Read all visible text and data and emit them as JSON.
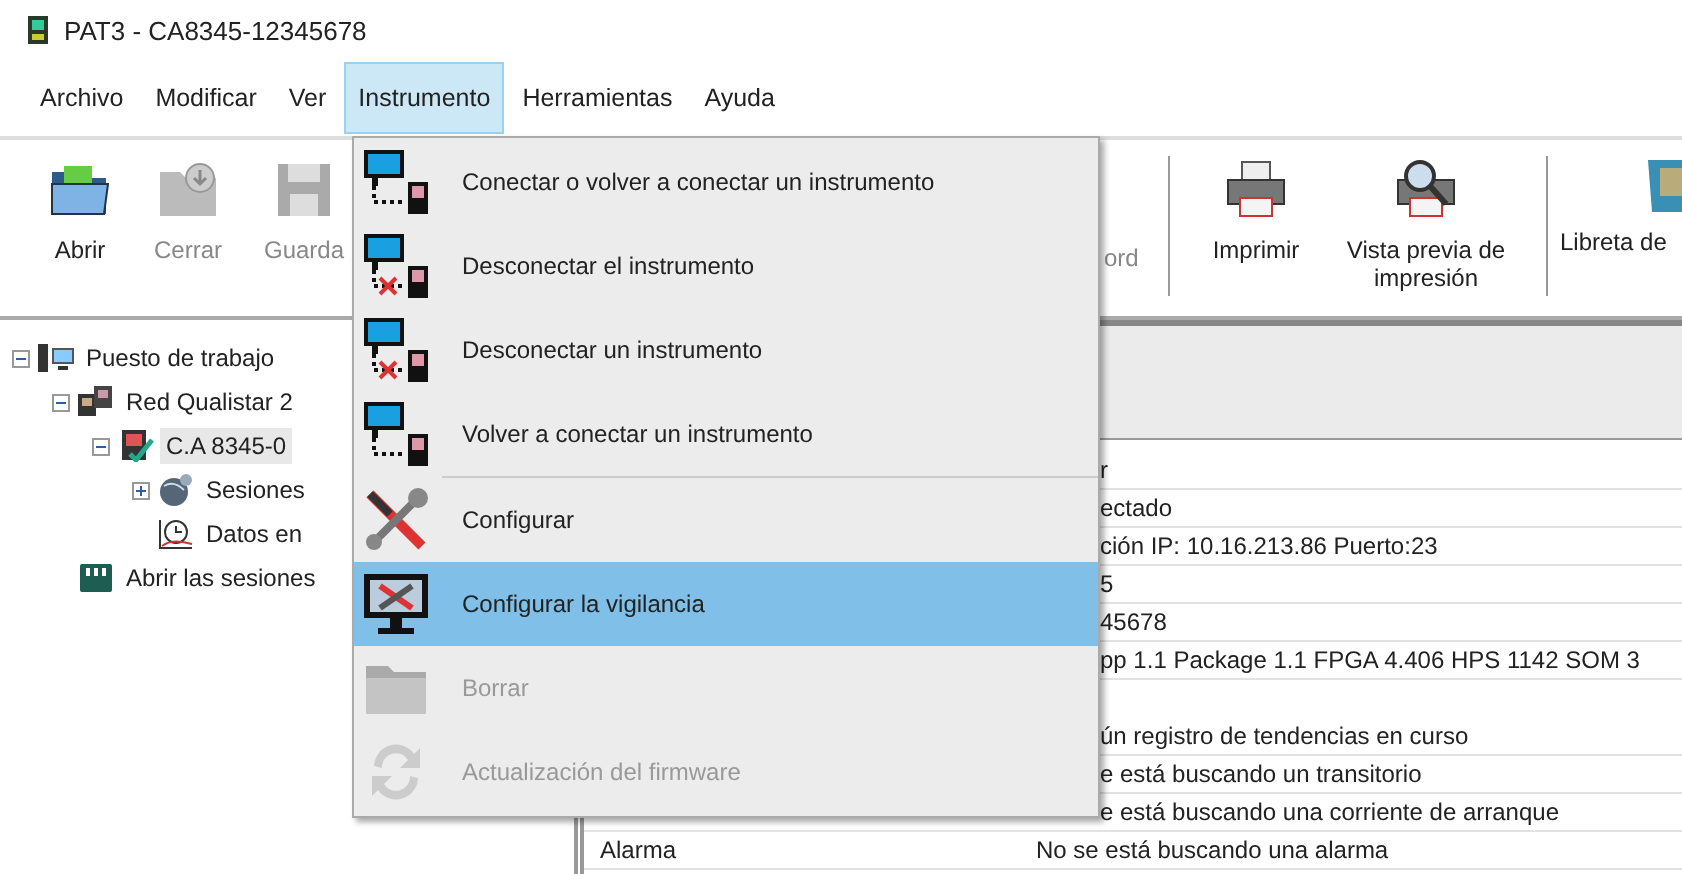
{
  "window": {
    "title": "PAT3 - CA8345-12345678"
  },
  "menu_bar": [
    {
      "label": "Archivo",
      "selected": false
    },
    {
      "label": "Modificar",
      "selected": false
    },
    {
      "label": "Ver",
      "selected": false
    },
    {
      "label": "Instrumento",
      "selected": true
    },
    {
      "label": "Herramientas",
      "selected": false
    },
    {
      "label": "Ayuda",
      "selected": false
    }
  ],
  "toolbar": [
    {
      "label": "Abrir",
      "kind": "open",
      "disabled": false
    },
    {
      "label": "Cerrar",
      "kind": "close",
      "disabled": true
    },
    {
      "label": "Guarda",
      "kind": "save",
      "disabled": true
    },
    {
      "label": "ord",
      "kind": "fragment",
      "disabled": true
    },
    {
      "label": "Imprimir",
      "kind": "print",
      "disabled": false
    },
    {
      "label": "Vista previa de impresión",
      "kind": "preview",
      "disabled": false
    },
    {
      "label": "Libreta de",
      "kind": "book",
      "disabled": false
    }
  ],
  "tree": [
    {
      "label": "Puesto de trabajo",
      "kind": "workstation",
      "expanded": true,
      "selected": false,
      "children": [
        {
          "label": "Red Qualistar 2",
          "kind": "network",
          "expanded": true,
          "selected": false,
          "children": [
            {
              "label": "C.A 8345-0",
              "kind": "instrument",
              "expanded": true,
              "selected": true,
              "children": [
                {
                  "label": "Sesiones",
                  "kind": "sessions",
                  "expanded": false,
                  "selected": false
                },
                {
                  "label": "Datos en",
                  "kind": "realtime",
                  "selected": false
                }
              ]
            }
          ]
        },
        {
          "label": "Abrir las sesiones",
          "kind": "card",
          "selected": false
        }
      ]
    }
  ],
  "instrument_menu": [
    {
      "label": "Conectar o volver a conectar un instrumento",
      "kind": "connect",
      "selected": false,
      "disabled": false
    },
    {
      "label": "Desconectar el instrumento",
      "kind": "disconnect",
      "selected": false,
      "disabled": false
    },
    {
      "label": "Desconectar un instrumento",
      "kind": "disconnect",
      "selected": false,
      "disabled": false
    },
    {
      "label": "Volver a conectar un instrumento",
      "kind": "connect",
      "selected": false,
      "disabled": false
    },
    {
      "kind": "separator"
    },
    {
      "label": "Configurar",
      "kind": "tools",
      "selected": false,
      "disabled": false
    },
    {
      "label": "Configurar la vigilancia",
      "kind": "monitor",
      "selected": true,
      "disabled": false
    },
    {
      "label": "Borrar",
      "kind": "delete",
      "selected": false,
      "disabled": true
    },
    {
      "label": "Actualización del firmware",
      "kind": "update",
      "selected": false,
      "disabled": true
    }
  ],
  "details": [
    {
      "value": "r"
    },
    {
      "value": "ectado"
    },
    {
      "value": "ción IP: 10.16.213.86 Puerto:23"
    },
    {
      "value": "5"
    },
    {
      "value": "45678"
    },
    {
      "value": "pp 1.1 Package 1.1 FPGA 4.406 HPS 1142 SOM 3"
    },
    {
      "kind": "empty"
    },
    {
      "value": "ún registro de tendencias en curso"
    },
    {
      "value": "e está buscando un transitorio"
    },
    {
      "value": "e está buscando una corriente de arranque"
    },
    {
      "label": "Alarma",
      "value": "No se está buscando una alarma"
    }
  ]
}
